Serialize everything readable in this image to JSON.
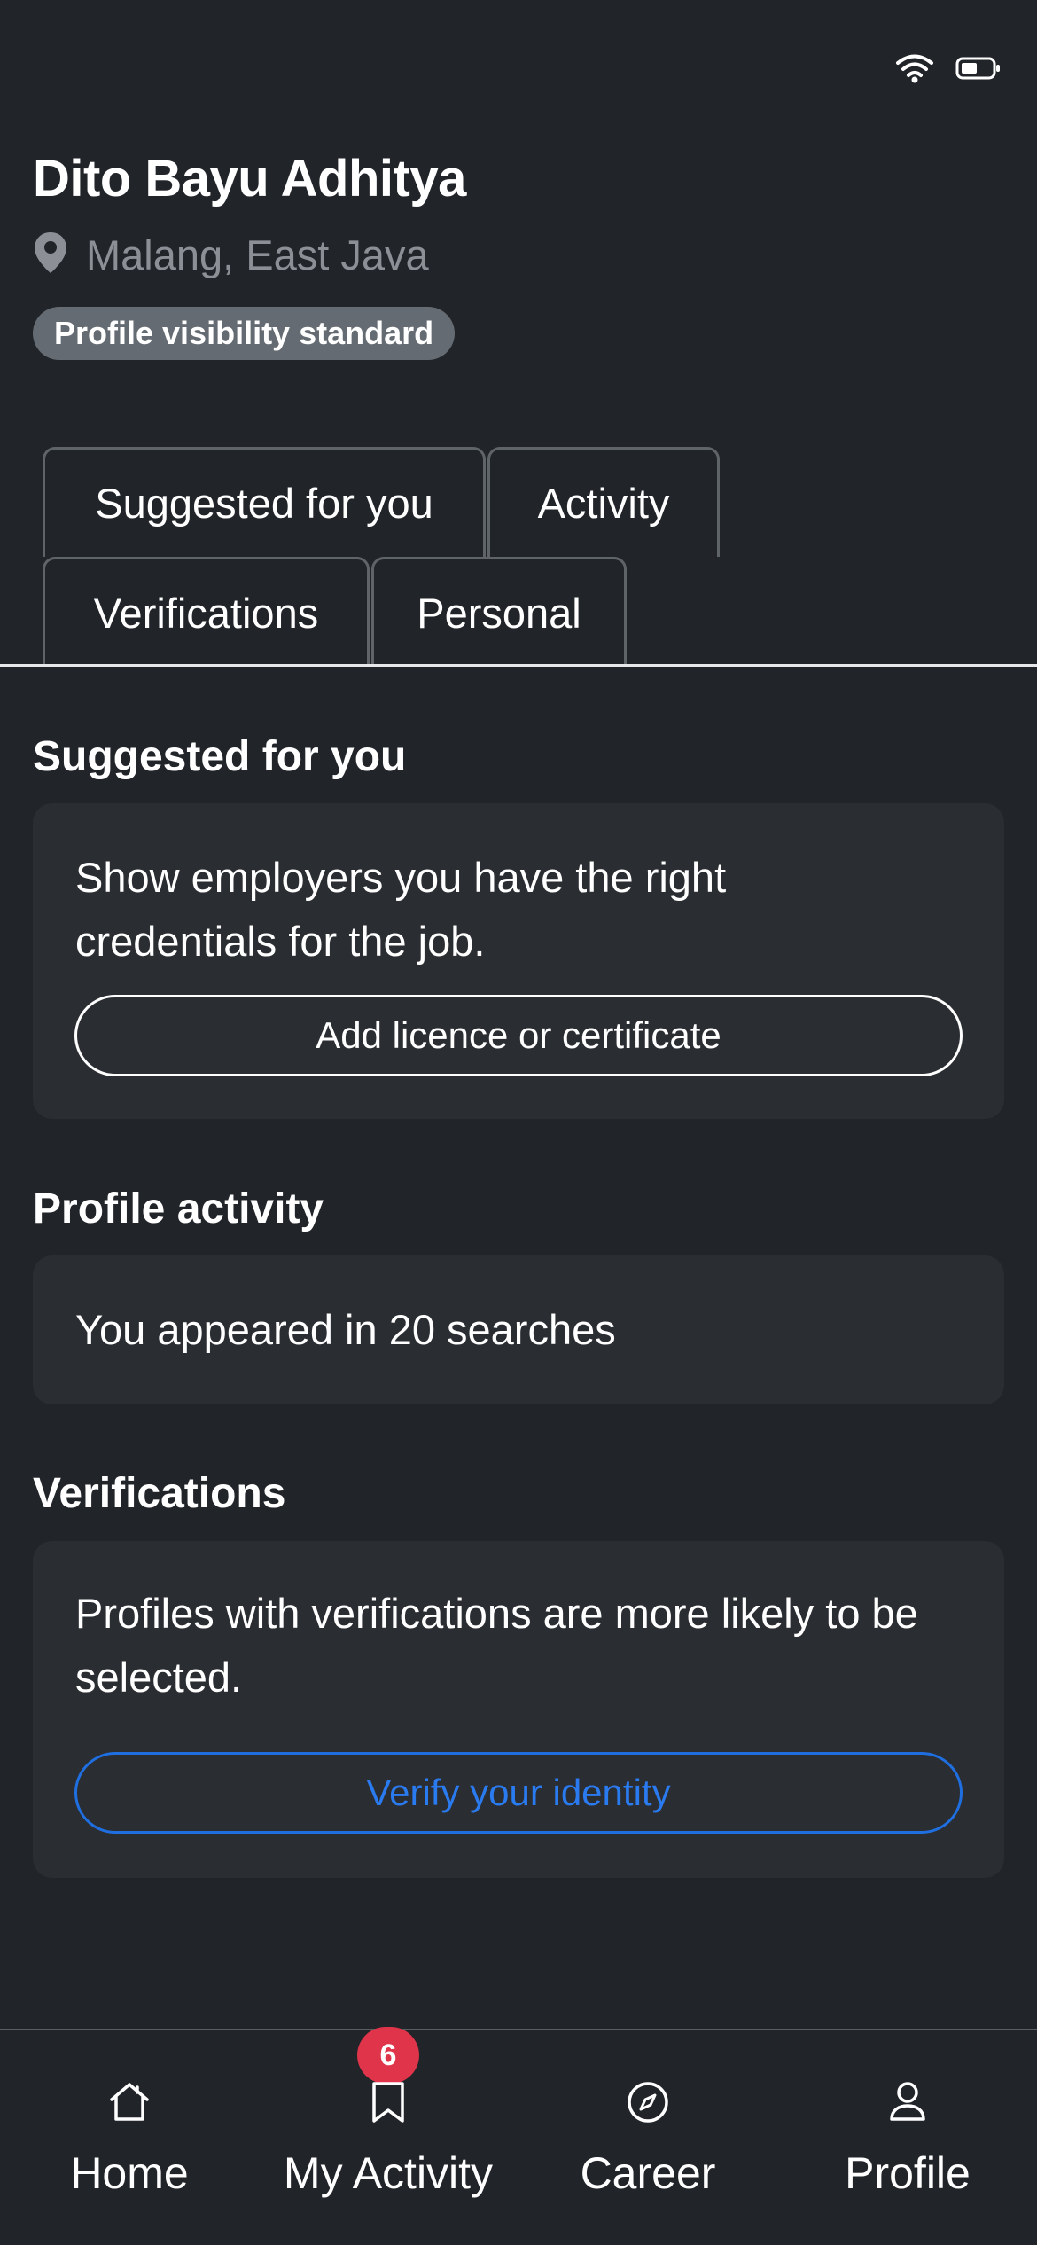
{
  "profile": {
    "name": "Dito Bayu Adhitya",
    "location": "Malang, East Java",
    "visibility_badge": "Profile visibility standard"
  },
  "tabs": [
    {
      "label": "Suggested for you"
    },
    {
      "label": "Activity"
    },
    {
      "label": "Verifications"
    },
    {
      "label": "Personal"
    }
  ],
  "suggested": {
    "title": "Suggested for you",
    "text": "Show employers you have the right credentials for the job.",
    "button_label": "Add licence or certificate"
  },
  "activity": {
    "title": "Profile activity",
    "text": "You appeared in 20 searches"
  },
  "verifications": {
    "title": "Verifications",
    "text": "Profiles with verifications are more likely to be selected.",
    "button_label": "Verify your identity"
  },
  "bottom_nav": {
    "items": [
      {
        "label": "Home",
        "icon": "home-icon"
      },
      {
        "label": "My Activity",
        "icon": "bookmark-icon",
        "badge": "6"
      },
      {
        "label": "Career",
        "icon": "compass-icon"
      },
      {
        "label": "Profile",
        "icon": "person-icon"
      }
    ]
  },
  "colors": {
    "background": "#212429",
    "card": "#2a2d32",
    "accent_blue": "#2a7bf0",
    "badge_red": "#e0344a",
    "muted_text": "#8c9096"
  }
}
